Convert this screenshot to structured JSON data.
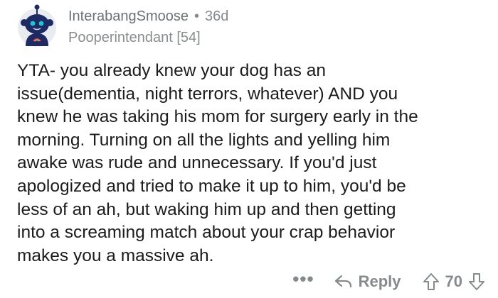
{
  "author": {
    "username": "InterabangSmoose",
    "separator": "•",
    "age": "36d",
    "flair": "Pooperintendant [54]"
  },
  "comment": {
    "body": "YTA- you already knew your dog has an\nissue(dementia, night terrors, whatever) AND you\nknew he was taking his mom for surgery early in the\nmorning. Turning on all the lights and yelling him\nawake was rude and unnecessary. If you'd just\napologized and tried to make it up to him, you'd be\nless of an ah, but waking him up and then getting\ninto a screaming match about your crap behavior\nmakes you a massive ah."
  },
  "actions": {
    "more_label": "•••",
    "reply_label": "Reply",
    "score": "70"
  },
  "icons": {
    "avatar": "reddit-snoo-avatar",
    "reply": "reply-arrow-icon",
    "upvote": "upvote-arrow-icon",
    "downvote": "downvote-arrow-icon",
    "more": "more-options-icon"
  },
  "colors": {
    "avatar_bg": "#e9ecef",
    "snoo_body": "#1e2a63",
    "snoo_face": "#d3d7ea",
    "snoo_eyes": "#18c8d6",
    "meta_text": "#878a8c",
    "body_text": "#1c1c1c"
  }
}
